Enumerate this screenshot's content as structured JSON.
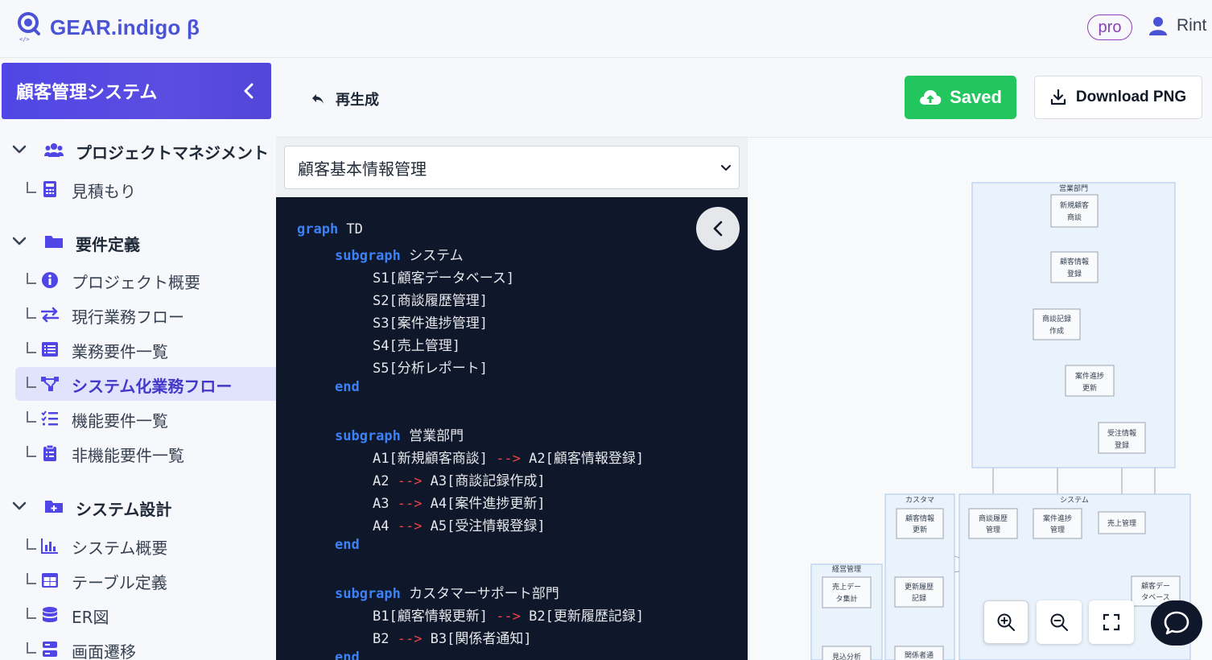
{
  "app": {
    "logo_text": "GEAR.indigo β",
    "plan_badge": "pro",
    "user_name": "Rint"
  },
  "colors": {
    "brand": "#4a52d6",
    "header_gradient": "#4f46e5",
    "saved": "#22c55e",
    "code_bg": "#0f172a",
    "keyword": "#3b82f6",
    "arrow": "#ef4444"
  },
  "sidebar": {
    "project_title": "顧客管理システム",
    "sections": [
      {
        "label": "プロジェクトマネジメント",
        "icon": "users-icon",
        "items": [
          {
            "label": "見積もり",
            "icon": "calculator-icon"
          }
        ]
      },
      {
        "label": "要件定義",
        "icon": "folder-icon",
        "items": [
          {
            "label": "プロジェクト概要",
            "icon": "info-icon"
          },
          {
            "label": "現行業務フロー",
            "icon": "swap-arrows-icon"
          },
          {
            "label": "業務要件一覧",
            "icon": "list-icon"
          },
          {
            "label": "システム化業務フロー",
            "icon": "flow-icon",
            "active": true
          },
          {
            "label": "機能要件一覧",
            "icon": "checklist-icon"
          },
          {
            "label": "非機能要件一覧",
            "icon": "clipboard-icon"
          }
        ]
      },
      {
        "label": "システム設計",
        "icon": "folder-plus-icon",
        "items": [
          {
            "label": "システム概要",
            "icon": "bar-chart-icon"
          },
          {
            "label": "テーブル定義",
            "icon": "table-icon"
          },
          {
            "label": "ER図",
            "icon": "database-icon"
          },
          {
            "label": "画面遷移",
            "icon": "screens-icon"
          }
        ]
      }
    ]
  },
  "toolbar": {
    "regenerate_label": "再生成",
    "saved_label": "Saved",
    "download_label": "Download PNG"
  },
  "editor": {
    "selected_flow": "顧客基本情報管理",
    "code": {
      "l1_kw": "graph",
      "l1_rest": " TD",
      "l2_kw": "subgraph",
      "l2_rest": " システム",
      "l3": "S1[顧客データベース]",
      "l4": "S2[商談履歴管理]",
      "l5": "S3[案件進捗管理]",
      "l6": "S4[売上管理]",
      "l7": "S5[分析レポート]",
      "l8_kw": "end",
      "l9_kw": "subgraph",
      "l9_rest": " 営業部門",
      "l10_a": "A1[新規顧客商談] ",
      "l10_arr": "-->",
      "l10_b": " A2[顧客情報登録]",
      "l11_a": "A2 ",
      "l11_arr": "-->",
      "l11_b": " A3[商談記録作成]",
      "l12_a": "A3 ",
      "l12_arr": "-->",
      "l12_b": " A4[案件進捗更新]",
      "l13_a": "A4 ",
      "l13_arr": "-->",
      "l13_b": " A5[受注情報登録]",
      "l14_kw": "end",
      "l15_kw": "subgraph",
      "l15_rest": " カスタマーサポート部門",
      "l16_a": "B1[顧客情報更新] ",
      "l16_arr": "-->",
      "l16_b": " B2[更新履歴記録]",
      "l17_a": "B2 ",
      "l17_arr": "-->",
      "l17_b": " B3[関係者通知]",
      "l18_kw": "end"
    }
  },
  "diagram": {
    "groups": {
      "sales": "営業部門",
      "customer": "カスタマ",
      "system": "システム",
      "management": "経営管理"
    },
    "nodes": {
      "a1_l1": "新規顧客",
      "a1_l2": "商談",
      "a2_l1": "顧客情報",
      "a2_l2": "登録",
      "a3_l1": "商談記録",
      "a3_l2": "作成",
      "a4_l1": "案件進捗",
      "a4_l2": "更新",
      "a5_l1": "受注情報",
      "a5_l2": "登録",
      "b1_l1": "顧客情報",
      "b1_l2": "更新",
      "b2_l1": "更新履歴",
      "b2_l2": "記録",
      "b3_l1": "関係者通",
      "s2_l1": "商談履歴",
      "s2_l2": "管理",
      "s3_l1": "案件進捗",
      "s3_l2": "管理",
      "s4_l1": "売上管理",
      "s1_l1": "顧客デー",
      "s1_l2": "タベース",
      "m1_l1": "売上デー",
      "m1_l2": "タ集計",
      "m2_l1": "見込分析"
    }
  }
}
